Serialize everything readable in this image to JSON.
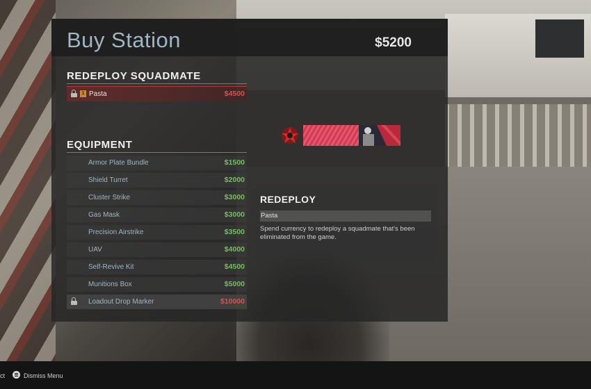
{
  "header": {
    "title": "Buy Station",
    "money": "$5200"
  },
  "redeploy_section": {
    "title": "REDEPLOY SQUADMATE",
    "items": [
      {
        "name": "Pasta",
        "price": "$4500",
        "locked": true,
        "badge": "1",
        "price_color": "red"
      }
    ]
  },
  "equipment_section": {
    "title": "EQUIPMENT",
    "items": [
      {
        "name": "Armor Plate Bundle",
        "price": "$1500",
        "locked": false
      },
      {
        "name": "Shield Turret",
        "price": "$2000",
        "locked": false
      },
      {
        "name": "Cluster Strike",
        "price": "$3000",
        "locked": false
      },
      {
        "name": "Gas Mask",
        "price": "$3000",
        "locked": false
      },
      {
        "name": "Precision Airstrike",
        "price": "$3500",
        "locked": false
      },
      {
        "name": "UAV",
        "price": "$4000",
        "locked": false
      },
      {
        "name": "Self-Revive Kit",
        "price": "$4500",
        "locked": false
      },
      {
        "name": "Munitions Box",
        "price": "$5000",
        "locked": false
      },
      {
        "name": "Loadout Drop Marker",
        "price": "$10000",
        "locked": true
      }
    ]
  },
  "detail": {
    "title": "REDEPLOY",
    "subtitle": "Pasta",
    "description": "Spend currency to redeploy a squadmate that's been eliminated from the game."
  },
  "bottom_bar": {
    "left_fragment": "ct",
    "dismiss_label": "Dismiss Menu",
    "dismiss_icon": "menu-button-icon"
  },
  "colors": {
    "affordable": "#73c05a",
    "unaffordable": "#d9534a",
    "title": "#9fb6c4"
  }
}
